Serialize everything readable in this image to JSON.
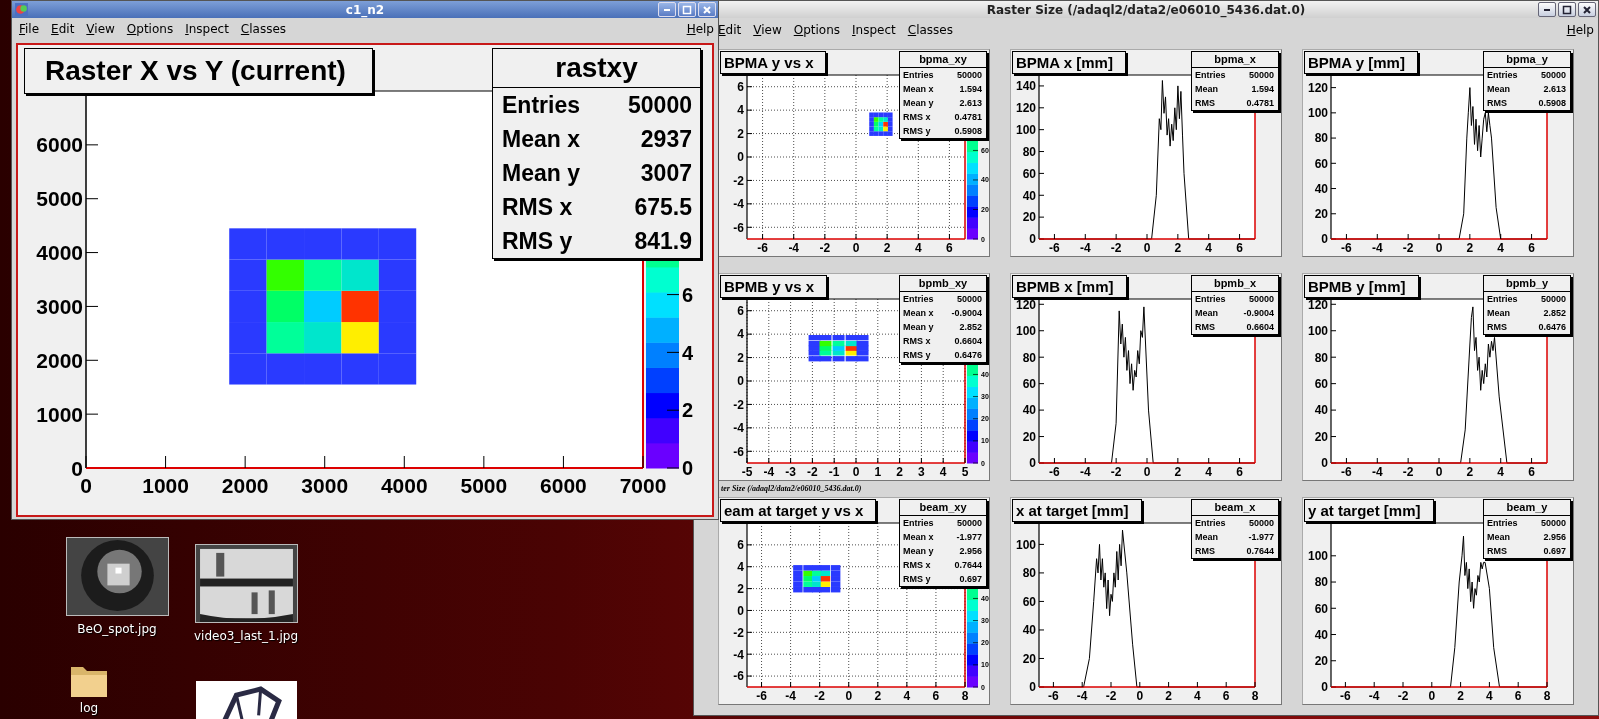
{
  "canvas_window": {
    "title": "c1_n2",
    "menu": [
      "File",
      "Edit",
      "View",
      "Options",
      "Inspect",
      "Classes"
    ],
    "help": "Help",
    "pad": {
      "title": "Raster X vs Y (current)",
      "color_scale": {
        "labels": [
          "6",
          "4",
          "2",
          "0"
        ]
      },
      "stats": {
        "name": "rastxy",
        "rows": [
          {
            "label": "Entries",
            "value": "50000"
          },
          {
            "label": "Mean x",
            "value": "2937"
          },
          {
            "label": "Mean y",
            "value": "3007"
          },
          {
            "label": "RMS x",
            "value": "675.5"
          },
          {
            "label": "RMS y",
            "value": "841.9"
          }
        ]
      },
      "chart_data": {
        "type": "scatter",
        "xlim": [
          0,
          7000
        ],
        "ylim": [
          0,
          7000
        ],
        "xticks": [
          0,
          1000,
          2000,
          3000,
          4000,
          5000,
          6000,
          7000
        ],
        "yticks": [
          0,
          1000,
          2000,
          3000,
          4000,
          5000,
          6000
        ],
        "x": [
          2035,
          2505,
          2975,
          3445,
          3915,
          2035,
          2505,
          2975,
          3445,
          3915,
          2035,
          2505,
          2975,
          3445,
          3915,
          2035,
          2505,
          2975,
          3445,
          3915,
          2035,
          2505,
          2975,
          3445,
          3915
        ],
        "values": [
          1840,
          1840,
          1840,
          1840,
          1840,
          2420,
          2420,
          2420,
          2420,
          2420,
          3000,
          3000,
          3000,
          3000,
          3000,
          3580,
          3580,
          3580,
          3580,
          3580,
          4160,
          4160,
          4160,
          4160,
          4160
        ]
      }
    }
  },
  "raster_window": {
    "title": "Raster Size (/adaql2/data2/e06010_5436.dat.0)",
    "menu": [
      "Edit",
      "View",
      "Options",
      "Inspect",
      "Classes"
    ],
    "help": "Help",
    "caption": "ter Size (/adaql2/data2/e06010_5436.dat.0)",
    "pads": [
      {
        "title": "BPMA y vs x",
        "color_scale": {
          "labels": [
            "60",
            "40",
            "20",
            "0"
          ]
        },
        "stats": {
          "name": "bpma_xy",
          "rows": [
            {
              "label": "Entries",
              "value": "50000"
            },
            {
              "label": "Mean x",
              "value": "1.594"
            },
            {
              "label": "Mean y",
              "value": "2.613"
            },
            {
              "label": "RMS x",
              "value": "0.4781"
            },
            {
              "label": "RMS y",
              "value": "0.5908"
            }
          ]
        },
        "chart_data": {
          "type": "scatter",
          "grid": true,
          "xlim": [
            -7,
            7
          ],
          "ylim": [
            -7,
            7
          ],
          "xticks": [
            -6,
            -4,
            -2,
            0,
            2,
            4,
            6
          ],
          "yticks": [
            -6,
            -4,
            -2,
            0,
            2,
            4,
            6
          ],
          "x": [
            1.0,
            1.3,
            1.6,
            1.9,
            2.2,
            1.0,
            1.3,
            1.6,
            1.9,
            2.2,
            1.0,
            1.3,
            1.6,
            1.9,
            2.2,
            1.0,
            1.3,
            1.6,
            1.9,
            2.2,
            1.0,
            1.3,
            1.6,
            1.9,
            2.2
          ],
          "values": [
            2.0,
            2.0,
            2.0,
            2.0,
            2.0,
            2.4,
            2.4,
            2.4,
            2.4,
            2.4,
            2.8,
            2.8,
            2.8,
            2.8,
            2.8,
            3.2,
            3.2,
            3.2,
            3.2,
            3.2,
            3.6,
            3.6,
            3.6,
            3.6,
            3.6
          ]
        }
      },
      {
        "title": "BPMA x [mm]",
        "stats": {
          "name": "bpma_x",
          "rows": [
            {
              "label": "Entries",
              "value": "50000"
            },
            {
              "label": "Mean",
              "value": "1.594"
            },
            {
              "label": "RMS",
              "value": "0.4781"
            }
          ]
        },
        "chart_data": {
          "type": "line",
          "xlim": [
            -7,
            7
          ],
          "ylim": [
            0,
            150
          ],
          "xticks": [
            -6,
            -4,
            -2,
            0,
            2,
            4,
            6
          ],
          "yticks": [
            0,
            20,
            40,
            60,
            80,
            100,
            120,
            140
          ],
          "x": [
            -7,
            0.3,
            0.6,
            0.8,
            0.9,
            1.0,
            1.1,
            1.2,
            1.3,
            1.4,
            1.5,
            1.6,
            1.7,
            1.8,
            1.9,
            2.0,
            2.1,
            2.2,
            2.3,
            2.4,
            2.7,
            7
          ],
          "values": [
            0,
            0,
            40,
            110,
            100,
            145,
            115,
            130,
            95,
            110,
            85,
            105,
            90,
            120,
            100,
            140,
            110,
            135,
            95,
            60,
            0,
            0
          ]
        }
      },
      {
        "title": "BPMA y [mm]",
        "stats": {
          "name": "bpma_y",
          "rows": [
            {
              "label": "Entries",
              "value": "50000"
            },
            {
              "label": "Mean",
              "value": "2.613"
            },
            {
              "label": "RMS",
              "value": "0.5908"
            }
          ]
        },
        "chart_data": {
          "type": "line",
          "xlim": [
            -7,
            7
          ],
          "ylim": [
            0,
            130
          ],
          "xticks": [
            -6,
            -4,
            -2,
            0,
            2,
            4,
            6
          ],
          "yticks": [
            0,
            20,
            40,
            60,
            80,
            100,
            120
          ],
          "x": [
            -7,
            1.3,
            1.6,
            1.8,
            1.9,
            2.0,
            2.1,
            2.2,
            2.3,
            2.4,
            2.5,
            2.6,
            2.7,
            2.8,
            2.9,
            3.0,
            3.1,
            3.2,
            3.3,
            3.4,
            3.7,
            4.0,
            7
          ],
          "values": [
            0,
            0,
            20,
            80,
            100,
            120,
            90,
            105,
            75,
            95,
            70,
            90,
            65,
            80,
            95,
            100,
            85,
            100,
            90,
            80,
            25,
            0,
            0
          ]
        }
      },
      {
        "title": "BPMB y vs x",
        "color_scale": {
          "labels": [
            "40",
            "30",
            "20",
            "10",
            "0"
          ]
        },
        "stats": {
          "name": "bpmb_xy",
          "rows": [
            {
              "label": "Entries",
              "value": "50000"
            },
            {
              "label": "Mean x",
              "value": "-0.9004"
            },
            {
              "label": "Mean y",
              "value": "2.852"
            },
            {
              "label": "RMS x",
              "value": "0.6604"
            },
            {
              "label": "RMS y",
              "value": "0.6476"
            }
          ]
        },
        "chart_data": {
          "type": "scatter",
          "grid": true,
          "xlim": [
            -5,
            5
          ],
          "ylim": [
            -7,
            7
          ],
          "xticks": [
            -5,
            -4,
            -3,
            -2,
            -1,
            0,
            1,
            2,
            3,
            4,
            5
          ],
          "yticks": [
            -6,
            -4,
            -2,
            0,
            2,
            4,
            6
          ],
          "x": [
            -1.9,
            -1.4,
            -0.8,
            -0.2,
            0.3,
            -1.9,
            -1.4,
            -0.8,
            -0.2,
            0.3,
            -1.9,
            -1.4,
            -0.8,
            -0.2,
            0.3,
            -1.9,
            -1.4,
            -0.8,
            -0.2,
            0.3,
            -1.9,
            -1.4,
            -0.8,
            -0.2,
            0.3
          ],
          "values": [
            1.9,
            1.9,
            1.9,
            1.9,
            1.9,
            2.4,
            2.4,
            2.4,
            2.4,
            2.4,
            2.8,
            2.8,
            2.8,
            2.8,
            2.8,
            3.2,
            3.2,
            3.2,
            3.2,
            3.2,
            3.7,
            3.7,
            3.7,
            3.7,
            3.7
          ]
        }
      },
      {
        "title": "BPMB x [mm]",
        "stats": {
          "name": "bpmb_x",
          "rows": [
            {
              "label": "Entries",
              "value": "50000"
            },
            {
              "label": "Mean",
              "value": "-0.9004"
            },
            {
              "label": "RMS",
              "value": "0.6604"
            }
          ]
        },
        "chart_data": {
          "type": "line",
          "xlim": [
            -7,
            7
          ],
          "ylim": [
            0,
            124
          ],
          "xticks": [
            -6,
            -4,
            -2,
            0,
            2,
            4,
            6
          ],
          "yticks": [
            0,
            20,
            40,
            60,
            80,
            100,
            120
          ],
          "x": [
            -7,
            -2.3,
            -2.0,
            -1.8,
            -1.7,
            -1.6,
            -1.5,
            -1.4,
            -1.3,
            -1.2,
            -1.1,
            -1.0,
            -0.9,
            -0.8,
            -0.7,
            -0.6,
            -0.5,
            -0.4,
            -0.3,
            -0.2,
            0.1,
            0.4,
            7
          ],
          "values": [
            0,
            0,
            30,
            115,
            90,
            105,
            80,
            95,
            70,
            85,
            60,
            75,
            55,
            70,
            65,
            85,
            75,
            100,
            95,
            118,
            40,
            0,
            0
          ]
        }
      },
      {
        "title": "BPMB y [mm]",
        "stats": {
          "name": "bpmb_y",
          "rows": [
            {
              "label": "Entries",
              "value": "50000"
            },
            {
              "label": "Mean",
              "value": "2.852"
            },
            {
              "label": "RMS",
              "value": "0.6476"
            }
          ]
        },
        "chart_data": {
          "type": "line",
          "xlim": [
            -7,
            7
          ],
          "ylim": [
            0,
            124
          ],
          "xticks": [
            -6,
            -4,
            -2,
            0,
            2,
            4,
            6
          ],
          "yticks": [
            0,
            20,
            40,
            60,
            80,
            100,
            120
          ],
          "x": [
            -7,
            1.4,
            1.7,
            2.0,
            2.1,
            2.2,
            2.3,
            2.4,
            2.5,
            2.6,
            2.7,
            2.8,
            2.9,
            3.0,
            3.1,
            3.2,
            3.3,
            3.4,
            3.5,
            3.6,
            3.9,
            4.4,
            7
          ],
          "values": [
            0,
            0,
            25,
            90,
            110,
            118,
            85,
            95,
            70,
            80,
            55,
            70,
            60,
            75,
            65,
            90,
            80,
            92,
            85,
            95,
            50,
            0,
            0
          ]
        }
      },
      {
        "title": "eam at target y vs x",
        "color_scale": {
          "labels": [
            "40",
            "30",
            "20",
            "10",
            "0"
          ]
        },
        "stats": {
          "name": "beam_xy",
          "rows": [
            {
              "label": "Entries",
              "value": "50000"
            },
            {
              "label": "Mean x",
              "value": "-1.977"
            },
            {
              "label": "Mean y",
              "value": "2.956"
            },
            {
              "label": "RMS x",
              "value": "0.7644"
            },
            {
              "label": "RMS y",
              "value": "0.697"
            }
          ]
        },
        "chart_data": {
          "type": "scatter",
          "grid": true,
          "xlim": [
            -7,
            8
          ],
          "ylim": [
            -7,
            8
          ],
          "xticks": [
            -6,
            -4,
            -2,
            0,
            2,
            4,
            6,
            8
          ],
          "yticks": [
            -6,
            -4,
            -2,
            0,
            2,
            4,
            6
          ],
          "x": [
            -3.5,
            -2.8,
            -2.2,
            -1.6,
            -0.9,
            -3.5,
            -2.8,
            -2.2,
            -1.6,
            -0.9,
            -3.5,
            -2.8,
            -2.2,
            -1.6,
            -0.9,
            -3.5,
            -2.8,
            -2.2,
            -1.6,
            -0.9,
            -3.5,
            -2.8,
            -2.2,
            -1.6,
            -0.9
          ],
          "values": [
            1.9,
            1.9,
            1.9,
            1.9,
            1.9,
            2.4,
            2.4,
            2.4,
            2.4,
            2.4,
            2.9,
            2.9,
            2.9,
            2.9,
            2.9,
            3.4,
            3.4,
            3.4,
            3.4,
            3.4,
            3.9,
            3.9,
            3.9,
            3.9,
            3.9
          ]
        }
      },
      {
        "title": "x at target [mm]",
        "stats": {
          "name": "beam_x",
          "rows": [
            {
              "label": "Entries",
              "value": "50000"
            },
            {
              "label": "Mean",
              "value": "-1.977"
            },
            {
              "label": "RMS",
              "value": "0.7644"
            }
          ]
        },
        "chart_data": {
          "type": "line",
          "xlim": [
            -7,
            8
          ],
          "ylim": [
            0,
            115
          ],
          "xticks": [
            -6,
            -4,
            -2,
            0,
            2,
            4,
            6,
            8
          ],
          "yticks": [
            0,
            20,
            40,
            60,
            80,
            100
          ],
          "x": [
            -7,
            -3.9,
            -3.5,
            -3.2,
            -3.0,
            -2.9,
            -2.8,
            -2.7,
            -2.6,
            -2.5,
            -2.4,
            -2.3,
            -2.2,
            -2.1,
            -2.0,
            -1.9,
            -1.8,
            -1.7,
            -1.6,
            -1.5,
            -1.4,
            -1.3,
            -1.2,
            -0.9,
            -0.5,
            -0.2,
            8
          ],
          "values": [
            0,
            0,
            20,
            60,
            90,
            80,
            100,
            75,
            90,
            70,
            80,
            55,
            75,
            50,
            65,
            60,
            80,
            70,
            95,
            75,
            100,
            85,
            110,
            80,
            30,
            0,
            0
          ]
        }
      },
      {
        "title": "y at target [mm]",
        "stats": {
          "name": "beam_y",
          "rows": [
            {
              "label": "Entries",
              "value": "50000"
            },
            {
              "label": "Mean",
              "value": "2.956"
            },
            {
              "label": "RMS",
              "value": "0.697"
            }
          ]
        },
        "chart_data": {
          "type": "line",
          "xlim": [
            -7,
            8
          ],
          "ylim": [
            0,
            125
          ],
          "xticks": [
            -6,
            -4,
            -2,
            0,
            2,
            4,
            6,
            8
          ],
          "yticks": [
            0,
            20,
            40,
            60,
            80,
            100
          ],
          "x": [
            -7,
            1.3,
            1.6,
            1.9,
            2.1,
            2.2,
            2.3,
            2.4,
            2.5,
            2.6,
            2.7,
            2.8,
            2.9,
            3.0,
            3.1,
            3.2,
            3.3,
            3.4,
            3.5,
            3.6,
            3.7,
            4.0,
            4.3,
            4.7,
            8
          ],
          "values": [
            0,
            0,
            30,
            80,
            100,
            115,
            85,
            95,
            75,
            90,
            65,
            80,
            60,
            75,
            70,
            85,
            80,
            95,
            90,
            95,
            95,
            75,
            30,
            0,
            0
          ]
        }
      }
    ]
  },
  "desktop": {
    "icons": [
      {
        "kind": "picture",
        "label": "BeO_spot.jpg"
      },
      {
        "kind": "picture",
        "label": "video3_last_1.jpg"
      },
      {
        "kind": "folder",
        "label": "log"
      },
      {
        "kind": "drawing"
      }
    ]
  }
}
